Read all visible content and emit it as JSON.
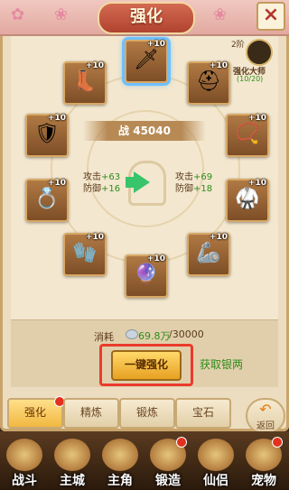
{
  "window": {
    "title": "强化",
    "close_glyph": "×"
  },
  "hero": {
    "level": "2阶",
    "name": "强化大师",
    "progress": "(10/20)"
  },
  "power": {
    "label": "战",
    "value": "45040"
  },
  "equipment": [
    {
      "icon": "sword-icon",
      "glyph": "🗡",
      "plus": "+10",
      "selected": true
    },
    {
      "icon": "boots-icon",
      "glyph": "👢",
      "plus": "+10"
    },
    {
      "icon": "helmet-icon",
      "glyph": "⛑",
      "plus": "+10"
    },
    {
      "icon": "shoulder-armor-icon",
      "glyph": "🛡",
      "plus": "+10"
    },
    {
      "icon": "necklace-icon",
      "glyph": "📿",
      "plus": "+10"
    },
    {
      "icon": "ring-icon",
      "glyph": "💍",
      "plus": "+10"
    },
    {
      "icon": "body-armor-icon",
      "glyph": "🥋",
      "plus": "+10"
    },
    {
      "icon": "bracer-icon",
      "glyph": "🧤",
      "plus": "+10"
    },
    {
      "icon": "gauntlet-icon",
      "glyph": "🦾",
      "plus": "+10"
    },
    {
      "icon": "amulet-icon",
      "glyph": "🔮",
      "plus": "+10"
    }
  ],
  "stats_before": {
    "attack_label": "攻击",
    "attack_value": "+63",
    "defense_label": "防御",
    "defense_value": "+16"
  },
  "stats_after": {
    "attack_label": "攻击",
    "attack_value": "+69",
    "defense_label": "防御",
    "defense_value": "+18"
  },
  "cost": {
    "label": "消耗",
    "current": "69.8万",
    "max": "/30000"
  },
  "actions": {
    "one_click": "一键强化",
    "get_silver": "获取银两"
  },
  "tabs": [
    {
      "label": "强化",
      "active": true,
      "badge": true
    },
    {
      "label": "精炼"
    },
    {
      "label": "锻炼"
    },
    {
      "label": "宝石"
    }
  ],
  "back": {
    "label": "返回"
  },
  "nav": [
    {
      "label": "战斗",
      "icon": "battle-icon"
    },
    {
      "label": "主城",
      "icon": "city-icon"
    },
    {
      "label": "主角",
      "icon": "hero-icon"
    },
    {
      "label": "锻造",
      "icon": "forge-icon",
      "badge": true
    },
    {
      "label": "仙侣",
      "icon": "companion-icon"
    },
    {
      "label": "宠物",
      "icon": "pet-icon",
      "badge": true
    }
  ]
}
